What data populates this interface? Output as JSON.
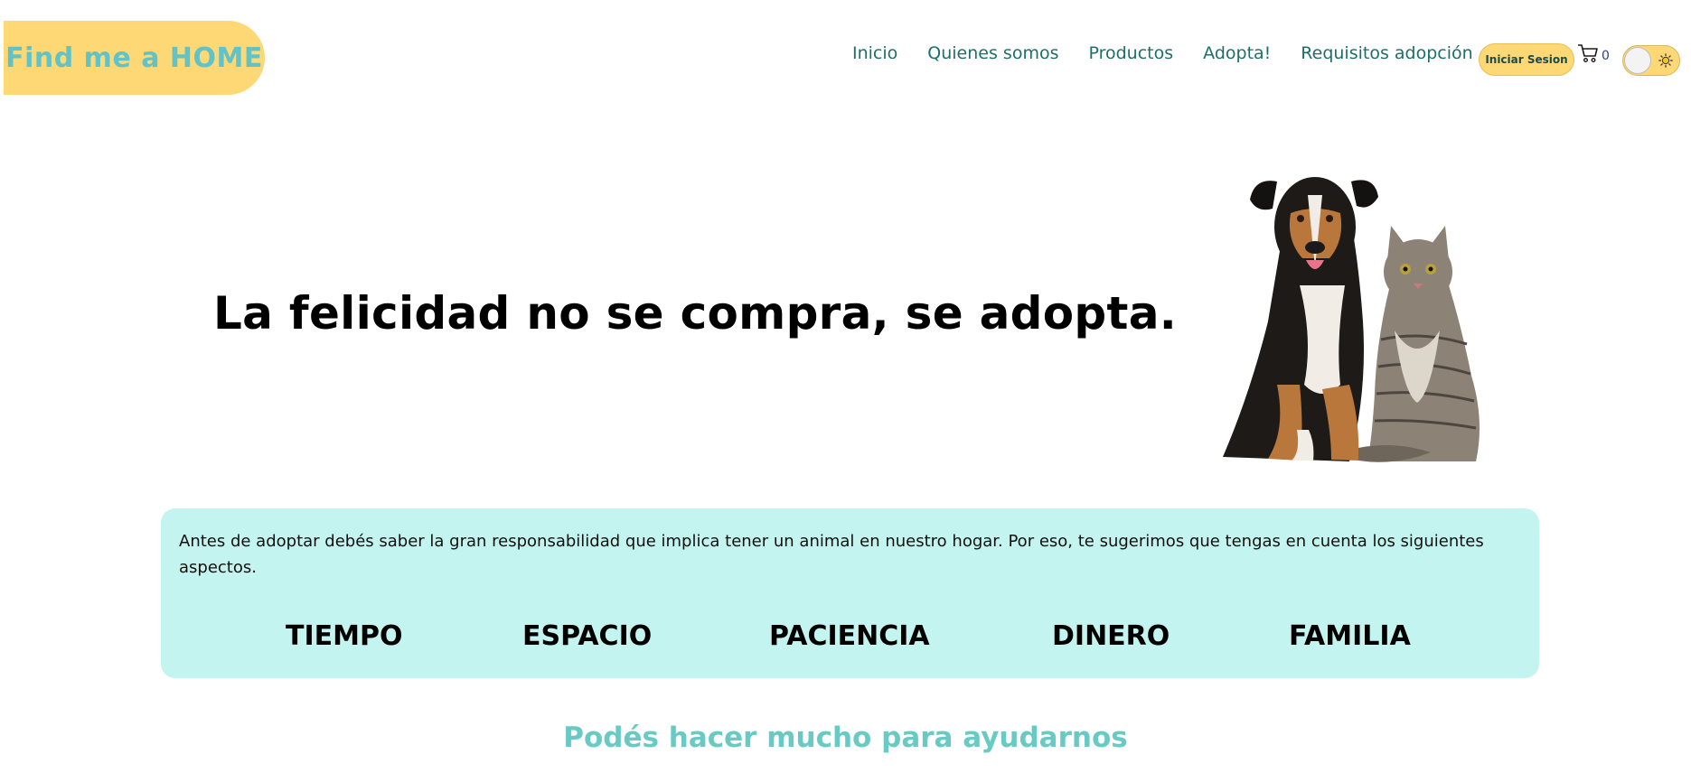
{
  "brand": {
    "logo_text": "Find me a HOME"
  },
  "nav": {
    "links": [
      "Inicio",
      "Quienes somos",
      "Productos",
      "Adopta!",
      "Requisitos adopción"
    ],
    "login_label": "Iniciar Sesion",
    "cart_count": "0"
  },
  "hero": {
    "headline": "La felicidad no se compra, se adopta."
  },
  "info": {
    "text": "Antes de adoptar debés saber la gran responsabilidad que implica tener un animal en nuestro hogar. Por eso, te sugerimos que tengas en cuenta los siguientes aspectos.",
    "aspects": [
      "TIEMPO",
      "ESPACIO",
      "PACIENCIA",
      "DINERO",
      "FAMILIA"
    ]
  },
  "help": {
    "title": "Podés hacer mucho para ayudarnos"
  },
  "icons": {
    "cart": "cart-icon",
    "theme": "sun-icon",
    "hero": "dog-and-cat-photo"
  },
  "colors": {
    "accent_yellow": "#fed874",
    "teal_text": "#5fc3c9",
    "nav_text": "#1c6f6a",
    "info_bg": "#c4f4f0"
  }
}
